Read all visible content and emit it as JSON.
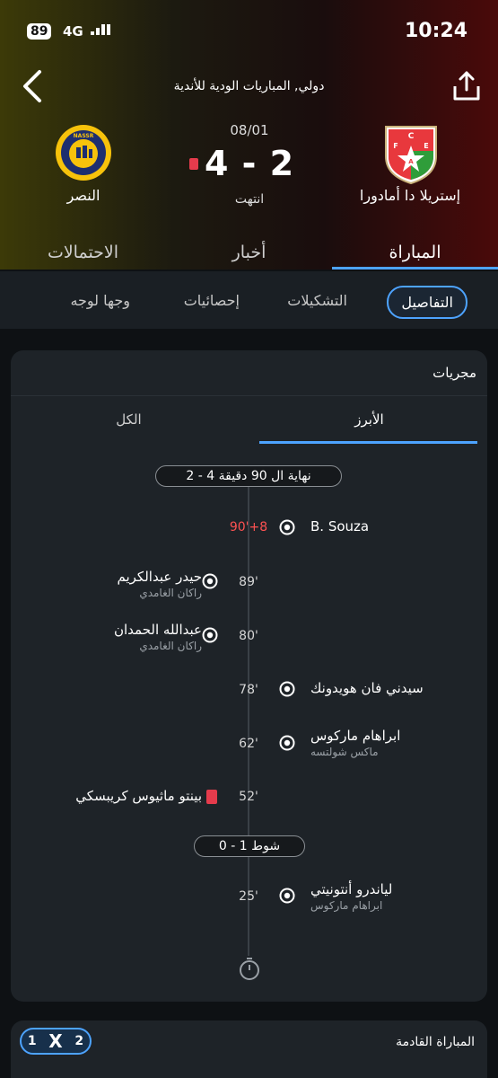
{
  "status_bar": {
    "time": "10:24",
    "battery": "89",
    "network": "4G"
  },
  "header": {
    "competition": "دولي, المباريات الودية للأندية",
    "date": "08/01",
    "score": "4 - 2",
    "status": "انتهت",
    "home_team": "إستريلا دا أمادورا",
    "away_team": "النصر",
    "home_logo_letters": [
      "C",
      "F",
      "E",
      "A"
    ],
    "away_logo_text": "NASSR"
  },
  "tabs": [
    {
      "label": "المباراة",
      "active": true
    },
    {
      "label": "أخبار",
      "active": false
    },
    {
      "label": "الاحتمالات",
      "active": false
    }
  ],
  "subtabs": [
    {
      "label": "التفاصيل",
      "active": true
    },
    {
      "label": "التشكيلات",
      "active": false
    },
    {
      "label": "إحصائيات",
      "active": false
    },
    {
      "label": "وجها لوجه",
      "active": false
    }
  ],
  "events": {
    "title": "مجريات",
    "filters": [
      {
        "label": "الأبرز",
        "active": true
      },
      {
        "label": "الكل",
        "active": false
      }
    ],
    "full_time_label": "نهاية ال 90 دقيقة 4 - 2",
    "half_time_label": "شوط 1 - 0",
    "items": [
      {
        "minute": "90'+8",
        "player": "B. Souza",
        "assist": "",
        "type": "goal"
      },
      {
        "minute": "89'",
        "player": "حيدر عبدالكريم",
        "assist": "راكان الغامدي",
        "type": "goal"
      },
      {
        "minute": "80'",
        "player": "عبدالله الحمدان",
        "assist": "راكان الغامدي",
        "type": "goal"
      },
      {
        "minute": "78'",
        "player": "سيدني فان هويدونك",
        "assist": "",
        "type": "goal"
      },
      {
        "minute": "62'",
        "player": "ابراهام ماركوس",
        "assist": "ماكس شولتسه",
        "type": "goal"
      },
      {
        "minute": "52'",
        "player": "بينتو ماثيوس كريبسكي",
        "assist": "",
        "type": "red-card"
      },
      {
        "minute": "25'",
        "player": "لياندرو أنتونيتي",
        "assist": "ابراهام ماركوس",
        "type": "goal"
      }
    ]
  },
  "next_match": {
    "title": "المباراة القادمة",
    "odds_badge": [
      "1",
      "X",
      "2"
    ]
  },
  "colors": {
    "accent": "#4da3ff",
    "red": "#e53b4c",
    "card_bg": "#1e2328"
  }
}
